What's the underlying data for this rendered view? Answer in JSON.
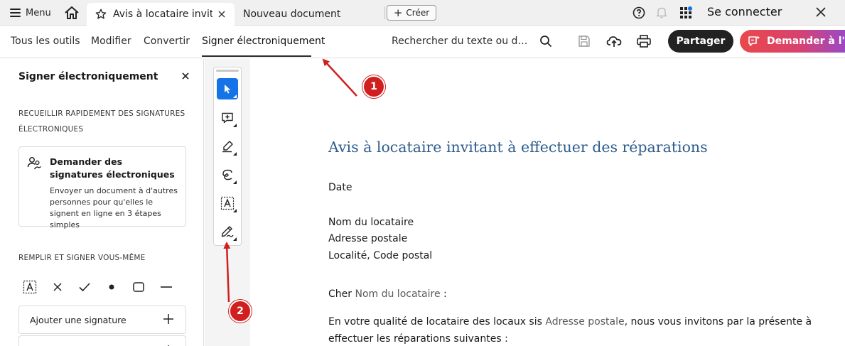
{
  "tabbar": {
    "menu_label": "Menu",
    "active_tab_title": "Avis à locataire invit…",
    "second_tab_title": "Nouveau document",
    "create_label": "Créer",
    "signin_label": "Se connecter"
  },
  "toolbar": {
    "nav": [
      "Tous les outils",
      "Modifier",
      "Convertir",
      "Signer électroniquement"
    ],
    "active_nav": "Signer électroniquement",
    "search_text": "Rechercher du texte ou des o…",
    "share_label": "Partager",
    "ask_label": "Demander à l'As"
  },
  "left_panel": {
    "title": "Signer électroniquement",
    "section1": "RECUEILLIR RAPIDEMENT DES SIGNATURES ÉLECTRONIQUES",
    "card_title": "Demander des signatures électroniques",
    "card_desc": "Envoyer un document à d'autres personnes pour qu'elles le signent en ligne en 3 étapes simples",
    "section2": "REMPLIR ET SIGNER VOUS-MÊME",
    "tools": [
      "text-field-icon",
      "cross-mark-icon",
      "check-mark-icon",
      "dot-icon",
      "rectangle-icon",
      "line-icon"
    ],
    "add_signature_label": "Ajouter une signature"
  },
  "vertical_tools": [
    "select-tool",
    "add-comment-tool",
    "highlight-tool",
    "draw-tool",
    "text-recognition-tool",
    "fill-sign-tool"
  ],
  "document": {
    "title": "Avis à locataire invitant à effectuer des réparations",
    "date": "Date",
    "tenant_name": "Nom du locataire",
    "address": "Adresse postale",
    "city": "Localité, Code postal",
    "greeting_prefix": "Cher ",
    "greeting_name": "Nom du locataire",
    "greeting_suffix": " :",
    "body_prefix": "En votre qualité de locataire des locaux sis ",
    "body_address": "Adresse postale",
    "body_suffix": ", nous vous invitons par la présente à",
    "body_line2": "effectuer les réparations suivantes :"
  },
  "annotations": {
    "badge1": "1",
    "badge2": "2",
    "color": "#d11f1f"
  }
}
